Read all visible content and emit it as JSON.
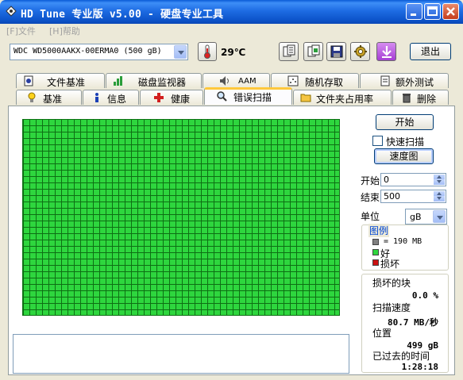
{
  "window": {
    "title": "HD Tune 专业版 v5.00 - 硬盘专业工具",
    "app_icon": "hdtune-diamond-icon",
    "controls": {
      "minimize": "_",
      "maximize": "□",
      "close": "✕"
    }
  },
  "menu": [
    {
      "label": "[F]文件"
    },
    {
      "label": "[H]帮助"
    }
  ],
  "toolbar": {
    "drive": "WDC WD5000AAKX-00ERMA0 (500 gB)",
    "temperature": "29℃",
    "exit_label": "退出",
    "icons": [
      "copy-text-icon",
      "copy-screenshot-icon",
      "save-icon",
      "options-gear-icon",
      "download-arrow-icon"
    ]
  },
  "tabs_top": [
    {
      "label": "文件基准",
      "icon": "file-benchmark-icon"
    },
    {
      "label": "磁盘监视器",
      "icon": "bar-chart-icon"
    },
    {
      "label": "AAM",
      "icon": "speaker-icon"
    },
    {
      "label": "随机存取",
      "icon": "random-access-icon"
    },
    {
      "label": "额外测试",
      "icon": "extra-tests-icon"
    }
  ],
  "tabs_bottom": [
    {
      "label": "基准",
      "icon": "lightbulb-icon"
    },
    {
      "label": "信息",
      "icon": "info-icon"
    },
    {
      "label": "健康",
      "icon": "health-cross-icon"
    },
    {
      "label": "错误扫描",
      "icon": "magnifier-icon",
      "active": true
    },
    {
      "label": "文件夹占用率",
      "icon": "folder-icon"
    },
    {
      "label": "删除",
      "icon": "trash-icon"
    }
  ],
  "scan": {
    "start_button": "开始",
    "quick_scan_label": "快速扫描",
    "quick_scan_checked": false,
    "speed_map_button": "速度图",
    "start_label": "开始",
    "start_value": "0",
    "end_label": "结束",
    "end_value": "500",
    "unit_label": "单位",
    "unit_value": "gB",
    "block_status": "all good",
    "block_color_good": "#2ed63e"
  },
  "legend": {
    "title": "图例",
    "block_size": "= 190 MB",
    "good": "好",
    "damaged": "损坏",
    "colors": {
      "block": "#808080",
      "good": "#2ed63e",
      "damaged": "#cc1111"
    }
  },
  "stats": {
    "damaged_blocks_label": "损坏的块",
    "damaged_blocks_value": "0.0 %",
    "scan_speed_label": "扫描速度",
    "scan_speed_value": "80.7 MB/秒",
    "position_label": "位置",
    "position_value": "499 gB",
    "elapsed_label": "已过去的时间",
    "elapsed_value": "1:28:18"
  },
  "log": {
    "text": ""
  }
}
